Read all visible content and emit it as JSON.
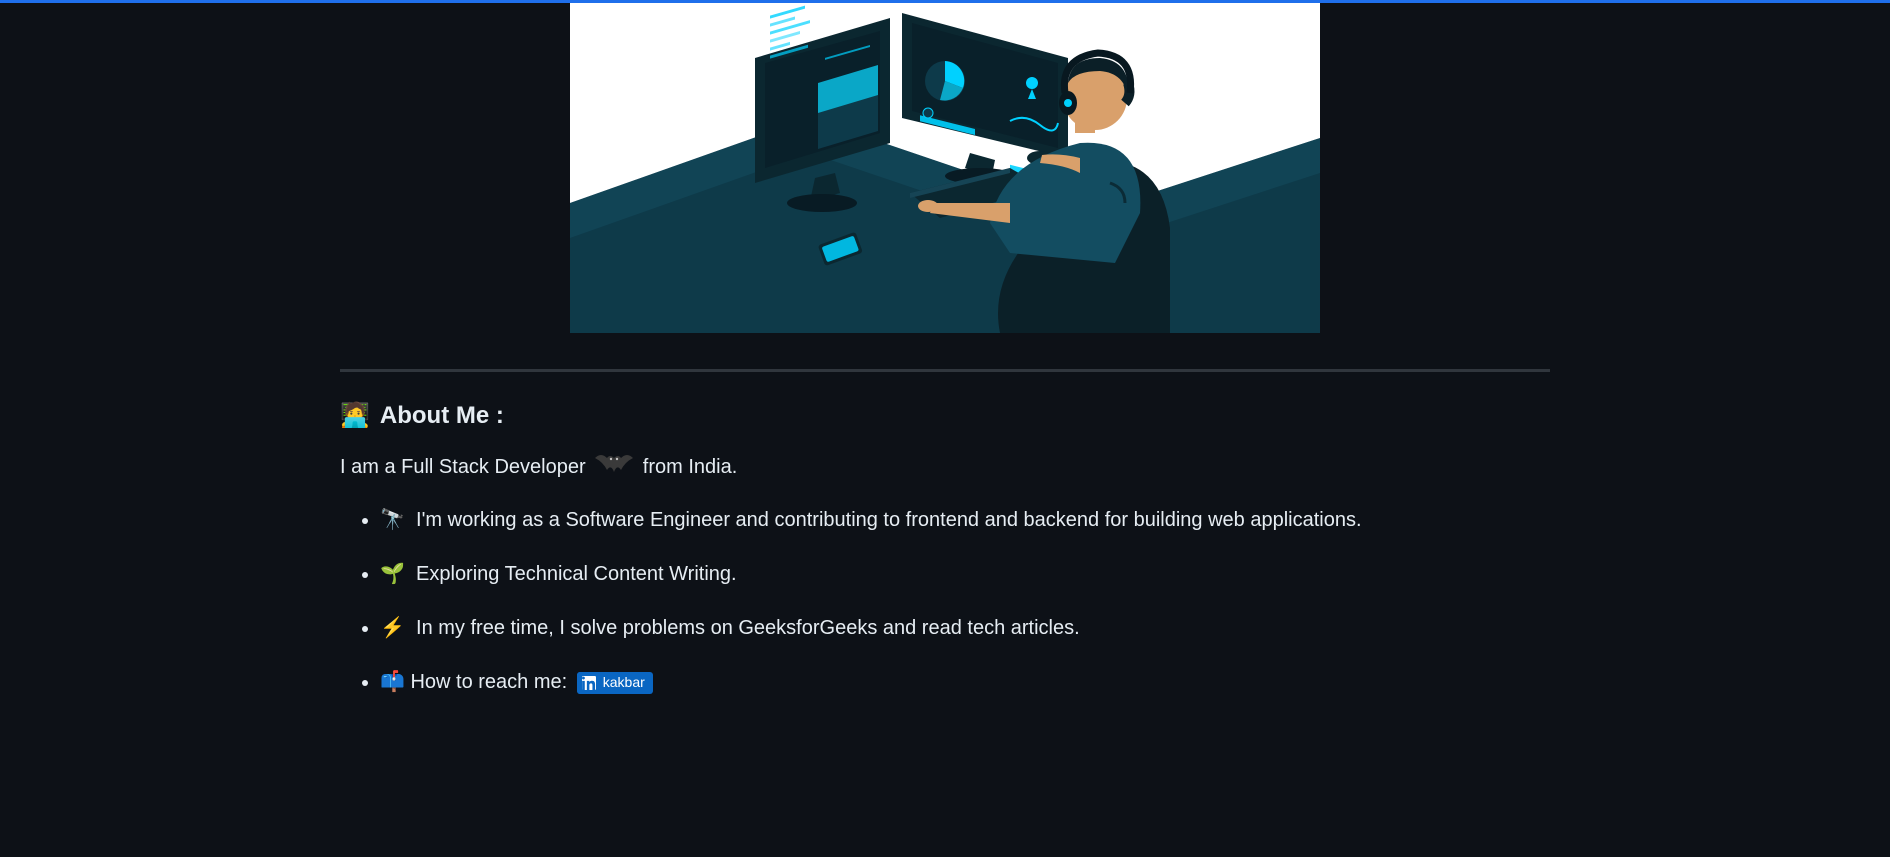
{
  "about": {
    "heading_emoji": "🧑‍💻",
    "heading": "About Me :",
    "intro_prefix": "I am a Full Stack Developer",
    "intro_suffix": "from India.",
    "items": [
      {
        "emoji": "🔭",
        "text": "I'm working as a Software Engineer and contributing to frontend and backend for building web applications."
      },
      {
        "emoji": "🌱",
        "text": "Exploring Technical Content Writing."
      },
      {
        "emoji": "⚡",
        "text": "In my free time, I solve problems on GeeksforGeeks and read tech articles."
      }
    ],
    "reach": {
      "emoji": "📫",
      "text": "How to reach me:",
      "badge_label": "kakbar"
    }
  }
}
